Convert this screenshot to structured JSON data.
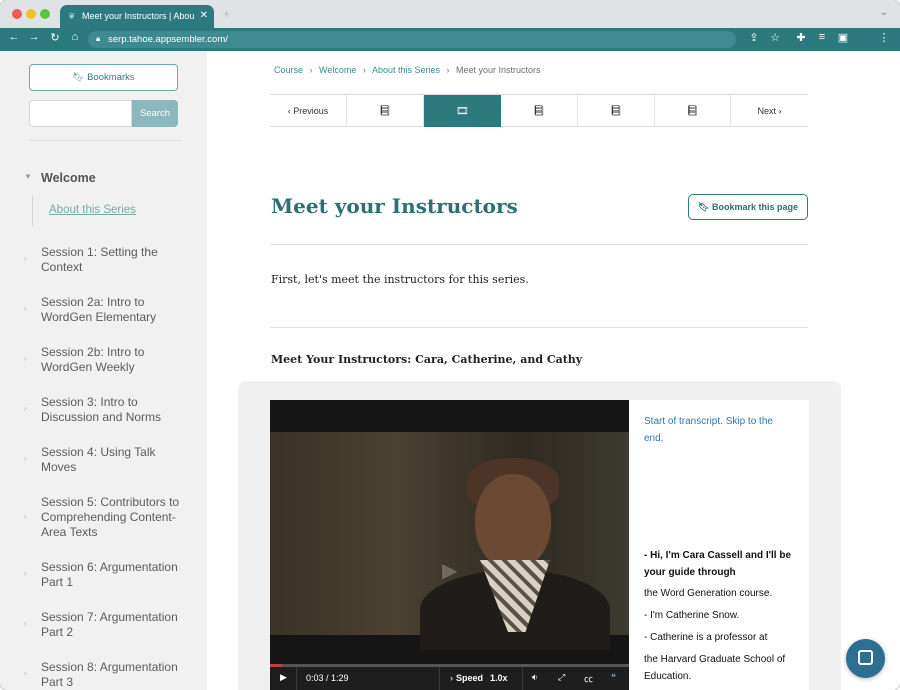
{
  "browser": {
    "tab_title": "Meet your Instructors | About t",
    "tab_close": "✕",
    "new_tab": "+",
    "url": "serp.tahoe.appsembler.com/"
  },
  "sidebar": {
    "bookmarks_label": "Bookmarks",
    "search_placeholder": "",
    "search_button": "Search",
    "section": "Welcome",
    "active_item": "About this Series",
    "sessions": [
      "Session 1: Setting the Context",
      "Session 2a: Intro to WordGen Elementary",
      "Session 2b: Intro to WordGen Weekly",
      "Session 3: Intro to Discussion and Norms",
      "Session 4: Using Talk Moves",
      "Session 5: Contributors to Comprehending Content-Area Texts",
      "Session 6: Argumentation Part 1",
      "Session 7: Argumentation Part 2",
      "Session 8: Argumentation Part 3"
    ]
  },
  "breadcrumb": {
    "course": "Course",
    "welcome": "Welcome",
    "about": "About this Series",
    "current": "Meet your Instructors",
    "separator": "›"
  },
  "stepnav": {
    "previous": "Previous",
    "next": "Next"
  },
  "main": {
    "title": "Meet your Instructors",
    "bookmark_page": "Bookmark this page",
    "intro": "First, let's meet the instructors for this series.",
    "video_heading": "Meet Your Instructors: Cara, Catherine, and Cathy"
  },
  "video": {
    "time": "0:03 / 1:29",
    "speed_label": "Speed",
    "speed_value": "1.0x",
    "progress_fraction": 0.034
  },
  "transcript": {
    "skip_link": "Start of transcript. Skip to the end.",
    "lines": [
      "- Hi, I'm Cara Cassell and I'll be your guide through",
      "the Word Generation course.",
      "- I'm Catherine Snow.",
      "- Catherine is a professor at",
      "the Harvard Graduate School of Education."
    ]
  },
  "colors": {
    "brand_teal": "#2d7a7e",
    "link_blue": "#2f77a8"
  }
}
